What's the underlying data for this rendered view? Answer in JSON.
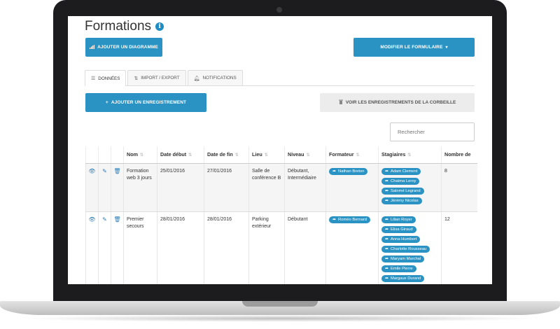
{
  "page": {
    "title": "Formations"
  },
  "toolbar": {
    "add_chart_label": "AJOUTER UN DIAGRAMME",
    "edit_form_label": "MODIFIER LE FORMULAIRE",
    "add_record_label": "AJOUTER UN ENREGISTREMENT",
    "trash_label": "VOIR LES ENREGISTREMENTS DE LA CORBEILLE"
  },
  "tabs": [
    {
      "label": "DONNÉES",
      "icon": "list-icon",
      "active": true
    },
    {
      "label": "IMPORT / EXPORT",
      "icon": "import-export-icon",
      "active": false
    },
    {
      "label": "NOTIFICATIONS",
      "icon": "bell-icon",
      "active": false
    }
  ],
  "search": {
    "placeholder": "Rechercher"
  },
  "table": {
    "columns": [
      "Nom",
      "Date début",
      "Date de fin",
      "Lieu",
      "Niveau",
      "Formateur",
      "Stagiaires",
      "Nombre de"
    ],
    "rows": [
      {
        "nom": "Formation web 3 jours",
        "date_debut": "25/01/2016",
        "date_fin": "27/01/2016",
        "lieu": "Salle de conférence B",
        "niveau": "Débutant, Intermédiaire",
        "formateur": "Nathan Breton",
        "stagiaires": [
          "Adam Clement",
          "Chaïma Leroy",
          "Salomé Legrand",
          "Jérémy Nicolas"
        ],
        "nombre": "8"
      },
      {
        "nom": "Premier secours",
        "date_debut": "28/01/2016",
        "date_fin": "28/01/2016",
        "lieu": "Parking extérieur",
        "niveau": "Débutant",
        "formateur": "Roméo Bernard",
        "stagiaires": [
          "Lilian Royer",
          "Elisa Giraud",
          "Anna Humbert",
          "Charlotte Rousseau",
          "Maryam Marchal",
          "Emile Pierre",
          "Margaux Durand"
        ],
        "nombre": "12"
      }
    ]
  },
  "colors": {
    "accent": "#2a93c4",
    "icon_blue": "#2a7fb8",
    "row_alt": "#f5f5f5"
  }
}
